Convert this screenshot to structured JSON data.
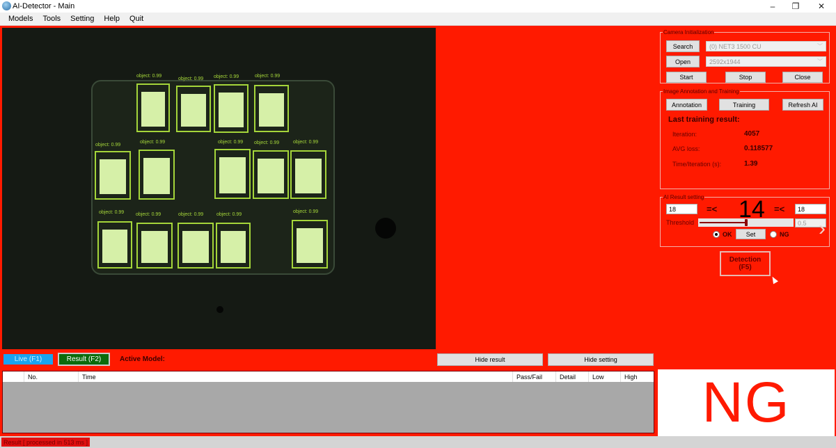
{
  "window": {
    "title": "AI-Detector - Main",
    "controls": {
      "minimize": "–",
      "maximize": "❐",
      "close": "✕"
    }
  },
  "menu": [
    "Models",
    "Tools",
    "Setting",
    "Help",
    "Quit"
  ],
  "camera_view": {
    "detection_label": "object: 0.99",
    "detection_count": 14
  },
  "camera_init": {
    "legend": "Camera Initialization",
    "search_label": "Search",
    "open_label": "Open",
    "camera_select": "(0) NET3 1500 CU",
    "resolution_select": "2592x1944",
    "start_label": "Start",
    "stop_label": "Stop",
    "close_label": "Close"
  },
  "training": {
    "legend": "Image Annotation and Training",
    "annotation_label": "Annotation",
    "training_label": "Training",
    "refresh_label": "Refresh AI",
    "heading": "Last training result:",
    "rows": [
      {
        "label": "Iteration:",
        "value": "4057"
      },
      {
        "label": "AVG loss:",
        "value": "0.118577"
      },
      {
        "label": "Time/Iteration (s):",
        "value": "1.39"
      }
    ]
  },
  "ai_result": {
    "legend": "AI Result setting",
    "low_value": "18",
    "operator": "=<",
    "count": "14",
    "high_value": "18",
    "threshold_label": "Threshold",
    "threshold_value": "0.5",
    "threshold_fraction": 0.5,
    "ok_label": "OK",
    "ng_label": "NG",
    "set_label": "Set",
    "selected": "OK",
    "next_icon": "›"
  },
  "detection_button": {
    "line1": "Detection",
    "line2": "(F5)"
  },
  "bottom": {
    "live_label": "Live (F1)",
    "result_label": "Result (F2)",
    "active_model_label": "Active Model:",
    "hide_result_label": "Hide result",
    "hide_setting_label": "Hide setting"
  },
  "table": {
    "columns": [
      "",
      "No.",
      "Time",
      "Pass/Fail",
      "Detail",
      "Low",
      "High"
    ]
  },
  "result_display": {
    "text": "NG"
  },
  "status": {
    "text": "Result [ processed in 513 ms ]"
  },
  "colors": {
    "background": "#ff1a00",
    "detection": "#a5d63a",
    "live": "#1aa3f0",
    "result": "#0b6b0b"
  }
}
